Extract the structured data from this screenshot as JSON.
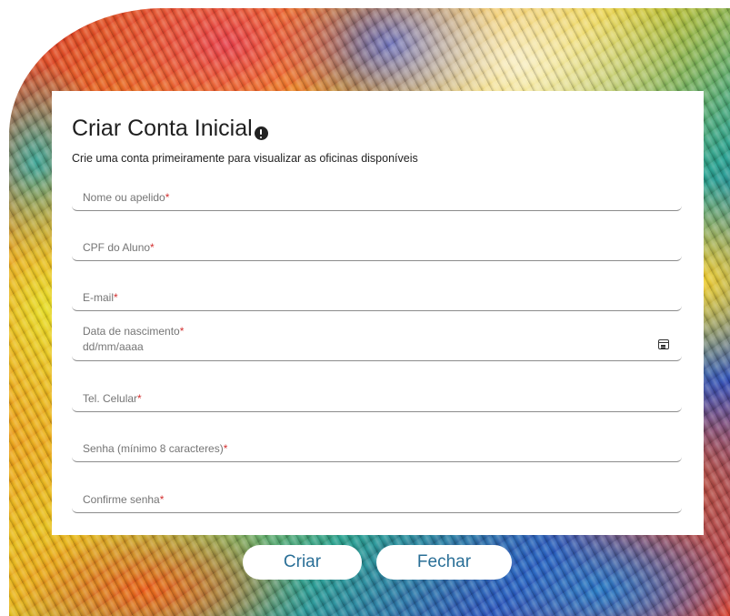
{
  "form": {
    "title": "Criar Conta Inicial",
    "subtitle": "Crie uma conta primeiramente para visualizar as oficinas disponíveis",
    "required_marker": "*",
    "fields": [
      {
        "label": "Nome ou apelido"
      },
      {
        "label": "CPF do Aluno"
      },
      {
        "label": "E-mail"
      },
      {
        "label": "Data de nascimento",
        "value": "dd/mm/aaaa"
      },
      {
        "label": "Tel. Celular"
      },
      {
        "label": "Senha (mínimo 8 caracteres)"
      },
      {
        "label": "Confirme senha"
      }
    ]
  },
  "buttons": {
    "create": "Criar",
    "close": "Fechar"
  },
  "icons": {
    "info": "info-icon",
    "calendar": "calendar-icon"
  },
  "colors": {
    "required": "#d32f2f",
    "button_text": "#2a6f97"
  }
}
